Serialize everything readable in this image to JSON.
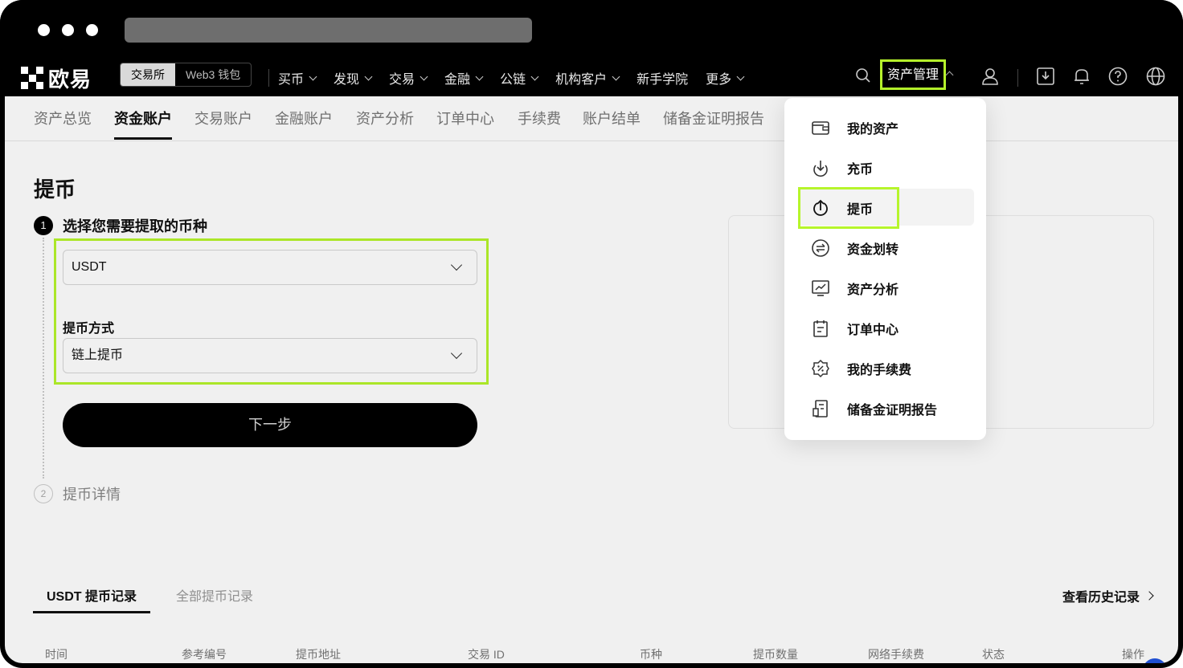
{
  "brand": {
    "name": "欧易"
  },
  "top_nav": {
    "segment": {
      "exchange": "交易所",
      "web3": "Web3 钱包"
    },
    "menu": [
      "买币",
      "发现",
      "交易",
      "金融",
      "公链",
      "机构客户",
      "新手学院",
      "更多"
    ],
    "menu_has_caret": [
      true,
      true,
      true,
      true,
      true,
      true,
      false,
      true
    ],
    "asset_management": "资产管理"
  },
  "sub_tabs": [
    "资产总览",
    "资金账户",
    "交易账户",
    "金融账户",
    "资产分析",
    "订单中心",
    "手续费",
    "账户结单",
    "储备金证明报告"
  ],
  "sub_tabs_active": 1,
  "withdraw": {
    "title": "提币",
    "step1": {
      "num": "1",
      "label": "选择您需要提取的币种"
    },
    "coin_select": {
      "value": "USDT"
    },
    "method_label": "提币方式",
    "method_select": {
      "value": "链上提币"
    },
    "next_button": "下一步",
    "step2": {
      "num": "2",
      "label": "提币详情"
    }
  },
  "records": {
    "tab_usdt": "USDT 提币记录",
    "tab_all": "全部提币记录",
    "history_link": "查看历史记录",
    "columns": [
      "时间",
      "参考编号",
      "提币地址",
      "交易 ID",
      "币种",
      "提币数量",
      "网络手续费",
      "状态",
      "操作"
    ]
  },
  "asset_dropdown": {
    "items": [
      {
        "label": "我的资产",
        "icon": "wallet-icon"
      },
      {
        "label": "充币",
        "icon": "deposit-icon"
      },
      {
        "label": "提币",
        "icon": "withdraw-icon"
      },
      {
        "label": "资金划转",
        "icon": "transfer-icon"
      },
      {
        "label": "资产分析",
        "icon": "analysis-icon"
      },
      {
        "label": "订单中心",
        "icon": "order-center-icon"
      },
      {
        "label": "我的手续费",
        "icon": "fee-icon"
      },
      {
        "label": "储备金证明报告",
        "icon": "proof-of-reserves-icon"
      }
    ],
    "active_item": "提币"
  },
  "colors": {
    "highlight": "#b6f52b",
    "nav_bg": "#000000",
    "button_bg": "#000000"
  }
}
